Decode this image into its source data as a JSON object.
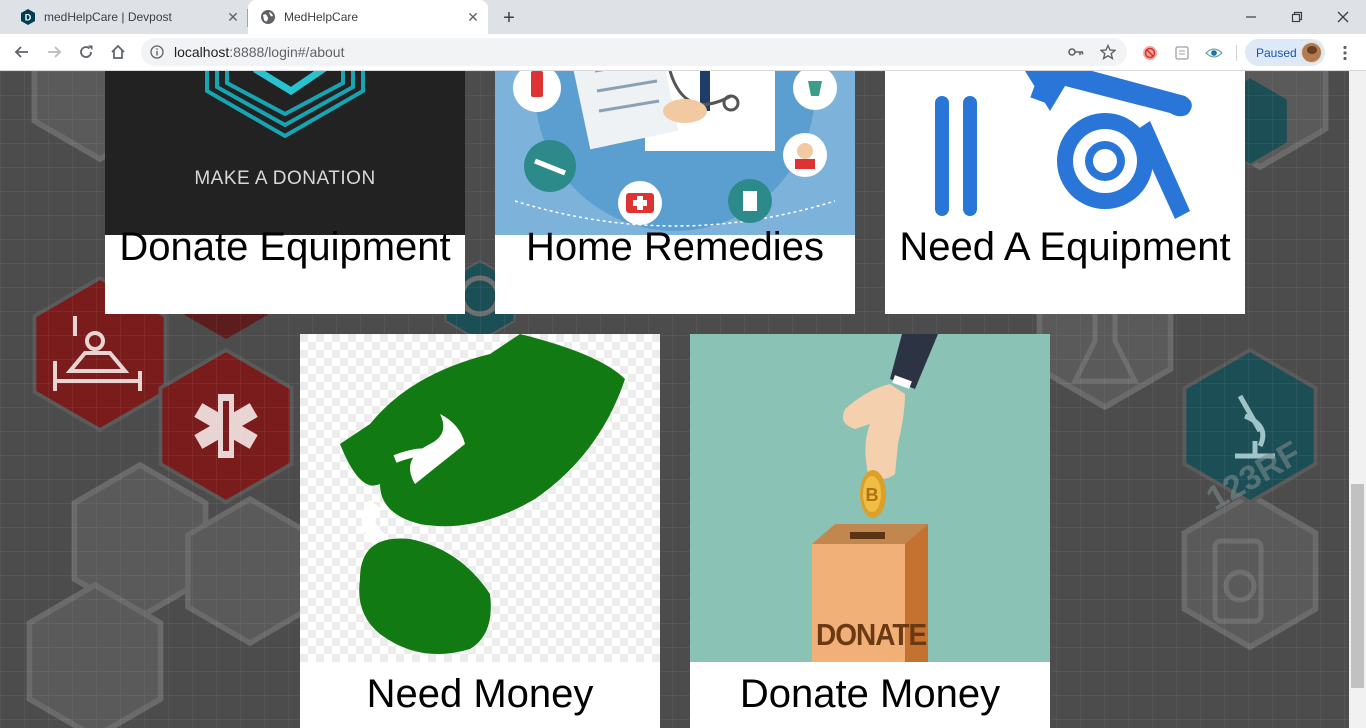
{
  "browser": {
    "tabs": [
      {
        "title": "medHelpCare | Devpost",
        "favicon": "devpost-logo-icon",
        "active": false
      },
      {
        "title": "MedHelpCare",
        "favicon": "globe-icon",
        "active": true
      }
    ],
    "address": {
      "host": "localhost",
      "rest": ":8888/login#/about"
    },
    "profile_label": "Paused"
  },
  "cards": [
    {
      "label": "Donate Equipment",
      "image_caption": "MAKE A DONATION",
      "icon": "donation-hexagon-icon"
    },
    {
      "label": "Home Remedies",
      "icon": "doctor-medical-icons-icon"
    },
    {
      "label": "Need A Equipment",
      "icon": "wheelchair-icon"
    },
    {
      "label": "Need Money",
      "icon": "hand-coin-icon"
    },
    {
      "label": "Donate Money",
      "image_caption": "DONATE",
      "icon": "donation-box-icon"
    }
  ],
  "colors": {
    "equipment_blue": "#2a75d8",
    "money_green": "#127a12",
    "donate_teal": "#8ac2b6",
    "hex_red": "#7a1c1c",
    "hex_teal": "#1c4e56"
  }
}
